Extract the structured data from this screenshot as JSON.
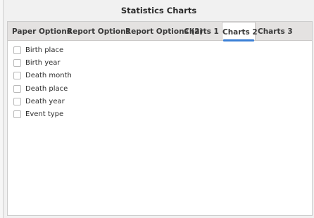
{
  "window": {
    "title": "Statistics Charts"
  },
  "tabs": [
    {
      "label": "Paper Options",
      "active": false
    },
    {
      "label": "Report Options",
      "active": false
    },
    {
      "label": "Report Options (2)",
      "active": false
    },
    {
      "label": "Charts 1",
      "active": false
    },
    {
      "label": "Charts 2",
      "active": true
    },
    {
      "label": "Charts 3",
      "active": false
    }
  ],
  "options": [
    {
      "label": "Birth place",
      "checked": false
    },
    {
      "label": "Birth year",
      "checked": false
    },
    {
      "label": "Death month",
      "checked": false
    },
    {
      "label": "Death place",
      "checked": false
    },
    {
      "label": "Death year",
      "checked": false
    },
    {
      "label": "Event type",
      "checked": false
    }
  ],
  "colors": {
    "active_tab_underline": "#3a7fd6",
    "tabbar_background": "#e4e2e1"
  }
}
